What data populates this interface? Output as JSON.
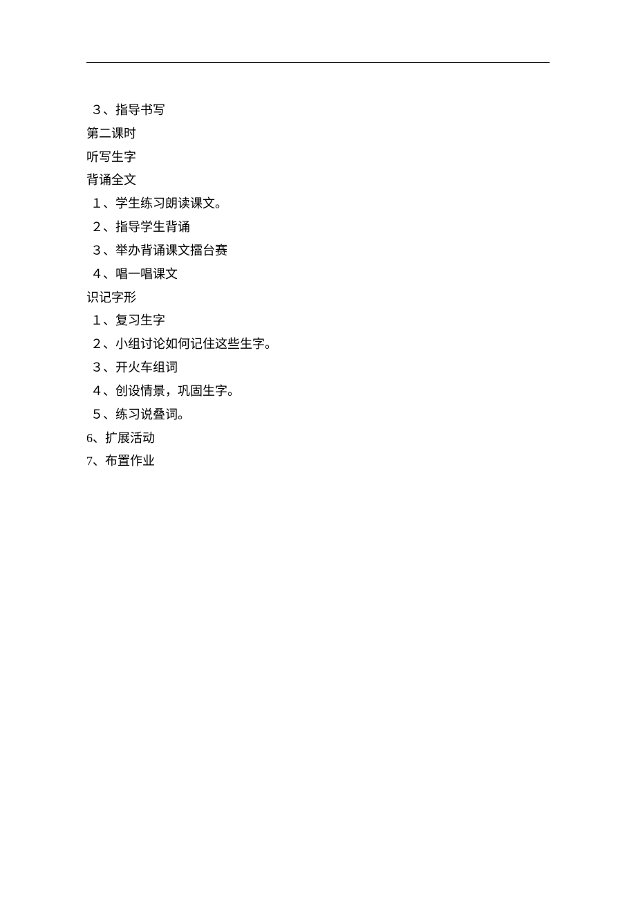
{
  "lines": [
    {
      "text": "３、指导书写",
      "indent": true
    },
    {
      "text": "第二课时",
      "indent": false
    },
    {
      "text": "听写生字",
      "indent": false
    },
    {
      "text": "背诵全文",
      "indent": false
    },
    {
      "text": "１、学生练习朗读课文。",
      "indent": true
    },
    {
      "text": "２、指导学生背诵",
      "indent": true
    },
    {
      "text": "３、举办背诵课文擂台赛",
      "indent": true
    },
    {
      "text": "４、唱一唱课文",
      "indent": true
    },
    {
      "text": "识记字形",
      "indent": false
    },
    {
      "text": "１、复习生字",
      "indent": true
    },
    {
      "text": "２、小组讨论如何记住这些生字。",
      "indent": true
    },
    {
      "text": "３、开火车组词",
      "indent": true
    },
    {
      "text": "４、创设情景，巩固生字。",
      "indent": true
    },
    {
      "text": "５、练习说叠词。",
      "indent": true
    },
    {
      "text": "6、扩展活动",
      "indent": false
    },
    {
      "text": "7、布置作业",
      "indent": false
    }
  ]
}
